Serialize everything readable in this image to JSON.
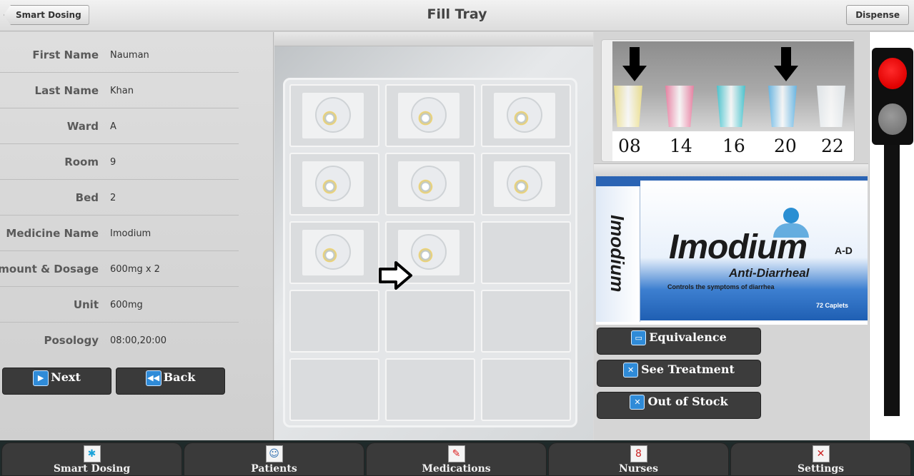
{
  "header": {
    "back_label": "Smart Dosing",
    "title": "Fill Tray",
    "dispense_label": "Dispense"
  },
  "patient_fields": [
    {
      "label": "First Name",
      "value": "Nauman"
    },
    {
      "label": "Last Name",
      "value": "Khan"
    },
    {
      "label": "Ward",
      "value": "A"
    },
    {
      "label": "Room",
      "value": "9"
    },
    {
      "label": "Bed",
      "value": "2"
    },
    {
      "label": "Medicine Name",
      "value": "Imodium"
    },
    {
      "label": "Amount & Dosage",
      "value": "600mg x 2"
    },
    {
      "label": "Unit",
      "value": "600mg"
    },
    {
      "label": "Posology",
      "value": "08:00,20:00"
    }
  ],
  "nav": {
    "next_label": "Next",
    "back_label": "Back",
    "next_icon": "play-icon",
    "back_icon": "rewind-icon"
  },
  "tray": {
    "cells_filled": [
      true,
      true,
      true,
      true,
      true,
      true,
      true,
      true,
      false,
      false,
      false,
      false,
      false,
      false,
      false
    ],
    "arrow_icon": "right-arrow-icon"
  },
  "cups": {
    "labels": [
      "08",
      "14",
      "16",
      "20",
      "22"
    ],
    "colors": [
      "#f3e58a",
      "#f07aa0",
      "#3cc6d2",
      "#5fb7ea",
      "#e8eef2"
    ],
    "marked": [
      "08",
      "20"
    ]
  },
  "medicine_box": {
    "brand": "Imodium",
    "subtitle": "Anti-Diarrheal",
    "ad": "A-D",
    "side_text": "Imodium",
    "controls_text": "Controls the symptoms of diarrhea",
    "count_text": "72 Caplets"
  },
  "actions": [
    {
      "label": "Equivalence",
      "icon": "equivalence-icon"
    },
    {
      "label": "See Treatment",
      "icon": "treatment-icon"
    },
    {
      "label": "Out of Stock",
      "icon": "out-of-stock-icon"
    }
  ],
  "traffic_light": {
    "active": "red",
    "colors": {
      "red": "#e00000",
      "off": "#8a8a8a"
    }
  },
  "tabs": [
    {
      "label": "Smart Dosing",
      "icon": "smart-dosing-icon",
      "glyph": "✱"
    },
    {
      "label": "Patients",
      "icon": "patients-icon",
      "glyph": "☺"
    },
    {
      "label": "Medications",
      "icon": "medications-icon",
      "glyph": "✎"
    },
    {
      "label": "Nurses",
      "icon": "nurses-icon",
      "glyph": "8"
    },
    {
      "label": "Settings",
      "icon": "settings-icon",
      "glyph": "✕"
    }
  ]
}
